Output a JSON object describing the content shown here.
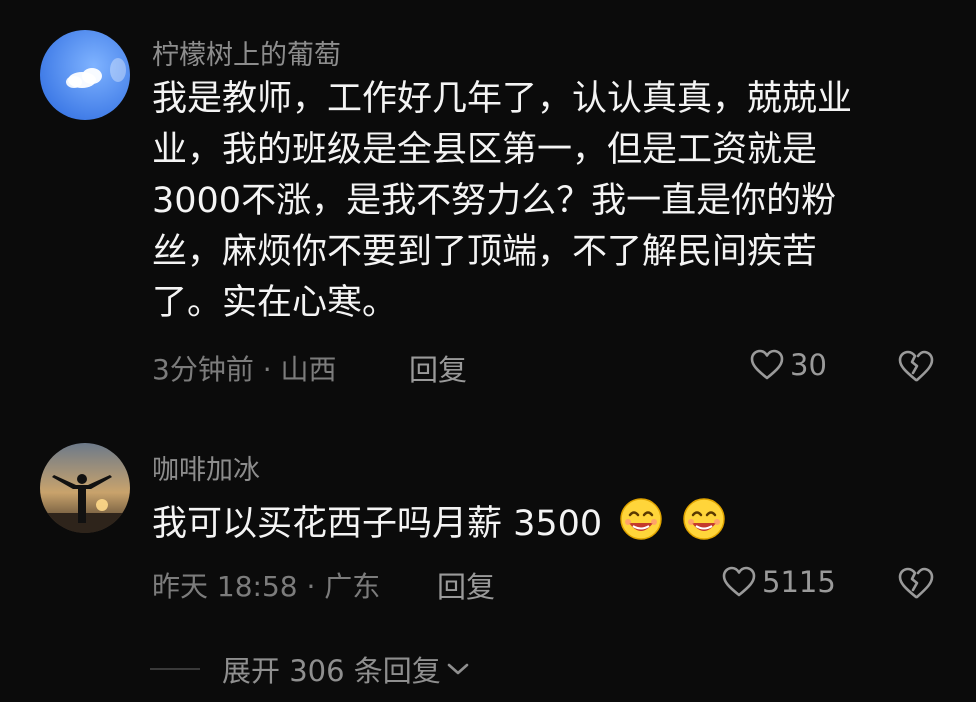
{
  "comments": [
    {
      "username": "柠檬树上的葡萄",
      "content_lines": [
        "我是教师，工作好几年了，认认真真，兢兢业",
        "业，我的班级是全县区第一，但是工资就是",
        "3000不涨，是我不努力么？我一直是你的粉",
        "丝，麻烦你不要到了顶端，不了解民间疾苦",
        "了。实在心寒。"
      ],
      "time_location": "3分钟前 · 山西",
      "reply_label": "回复",
      "likes": "30",
      "avatar_icon": "cloud-sky-icon",
      "like_icon": "heart-icon",
      "dislike_icon": "broken-heart-icon"
    },
    {
      "username": "咖啡加冰",
      "content_text": "我可以买花西子吗月薪 3500",
      "emojis": [
        "smiling-face-icon",
        "smiling-face-icon"
      ],
      "time_location": "昨天 18:58 · 广东",
      "reply_label": "回复",
      "likes": "5115",
      "avatar_icon": "sunset-silhouette-icon",
      "like_icon": "heart-icon",
      "dislike_icon": "broken-heart-icon"
    }
  ],
  "expand_replies": {
    "label": "展开 306 条回复",
    "icon": "chevron-down-icon"
  },
  "colors": {
    "background": "#0b0b0b",
    "primary_text": "#f4f4f4",
    "secondary_text": "#8d8d8d",
    "emoji_yellow": "#ffd53a"
  }
}
